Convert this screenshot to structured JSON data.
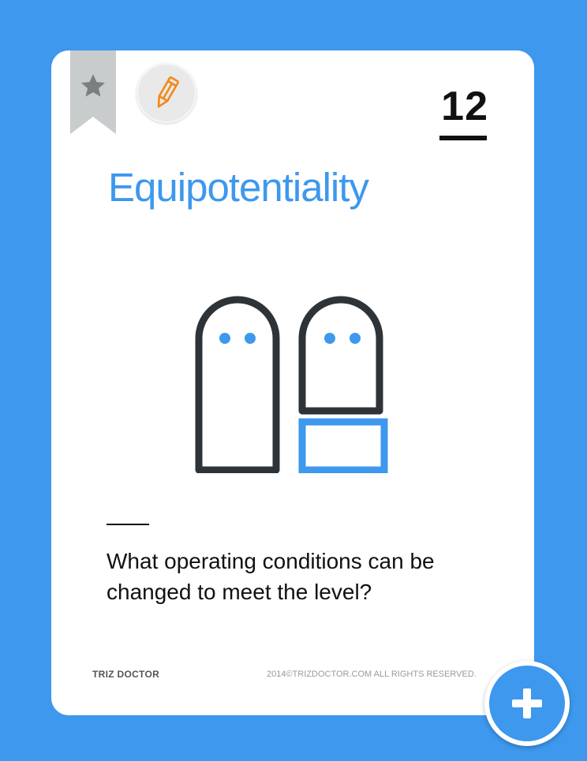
{
  "card": {
    "number": "12",
    "title": "Equipotentiality",
    "question": "What operating conditions can be changed to meet the level?",
    "brand": "TRIZ DOCTOR",
    "copyright": "2014©TRIZDOCTOR.COM  ALL RIGHTS RESERVED."
  },
  "icons": {
    "bookmark": "star-bookmark-icon",
    "edit": "pencil-icon",
    "add": "plus-icon",
    "illustration": "two-figures-with-block-icon"
  },
  "colors": {
    "background": "#3d98ee",
    "accent": "#3d98ee",
    "card": "#ffffff",
    "figure_outline": "#2e3338",
    "pencil": "#f08a1c",
    "bookmark": "#c9cccc"
  }
}
